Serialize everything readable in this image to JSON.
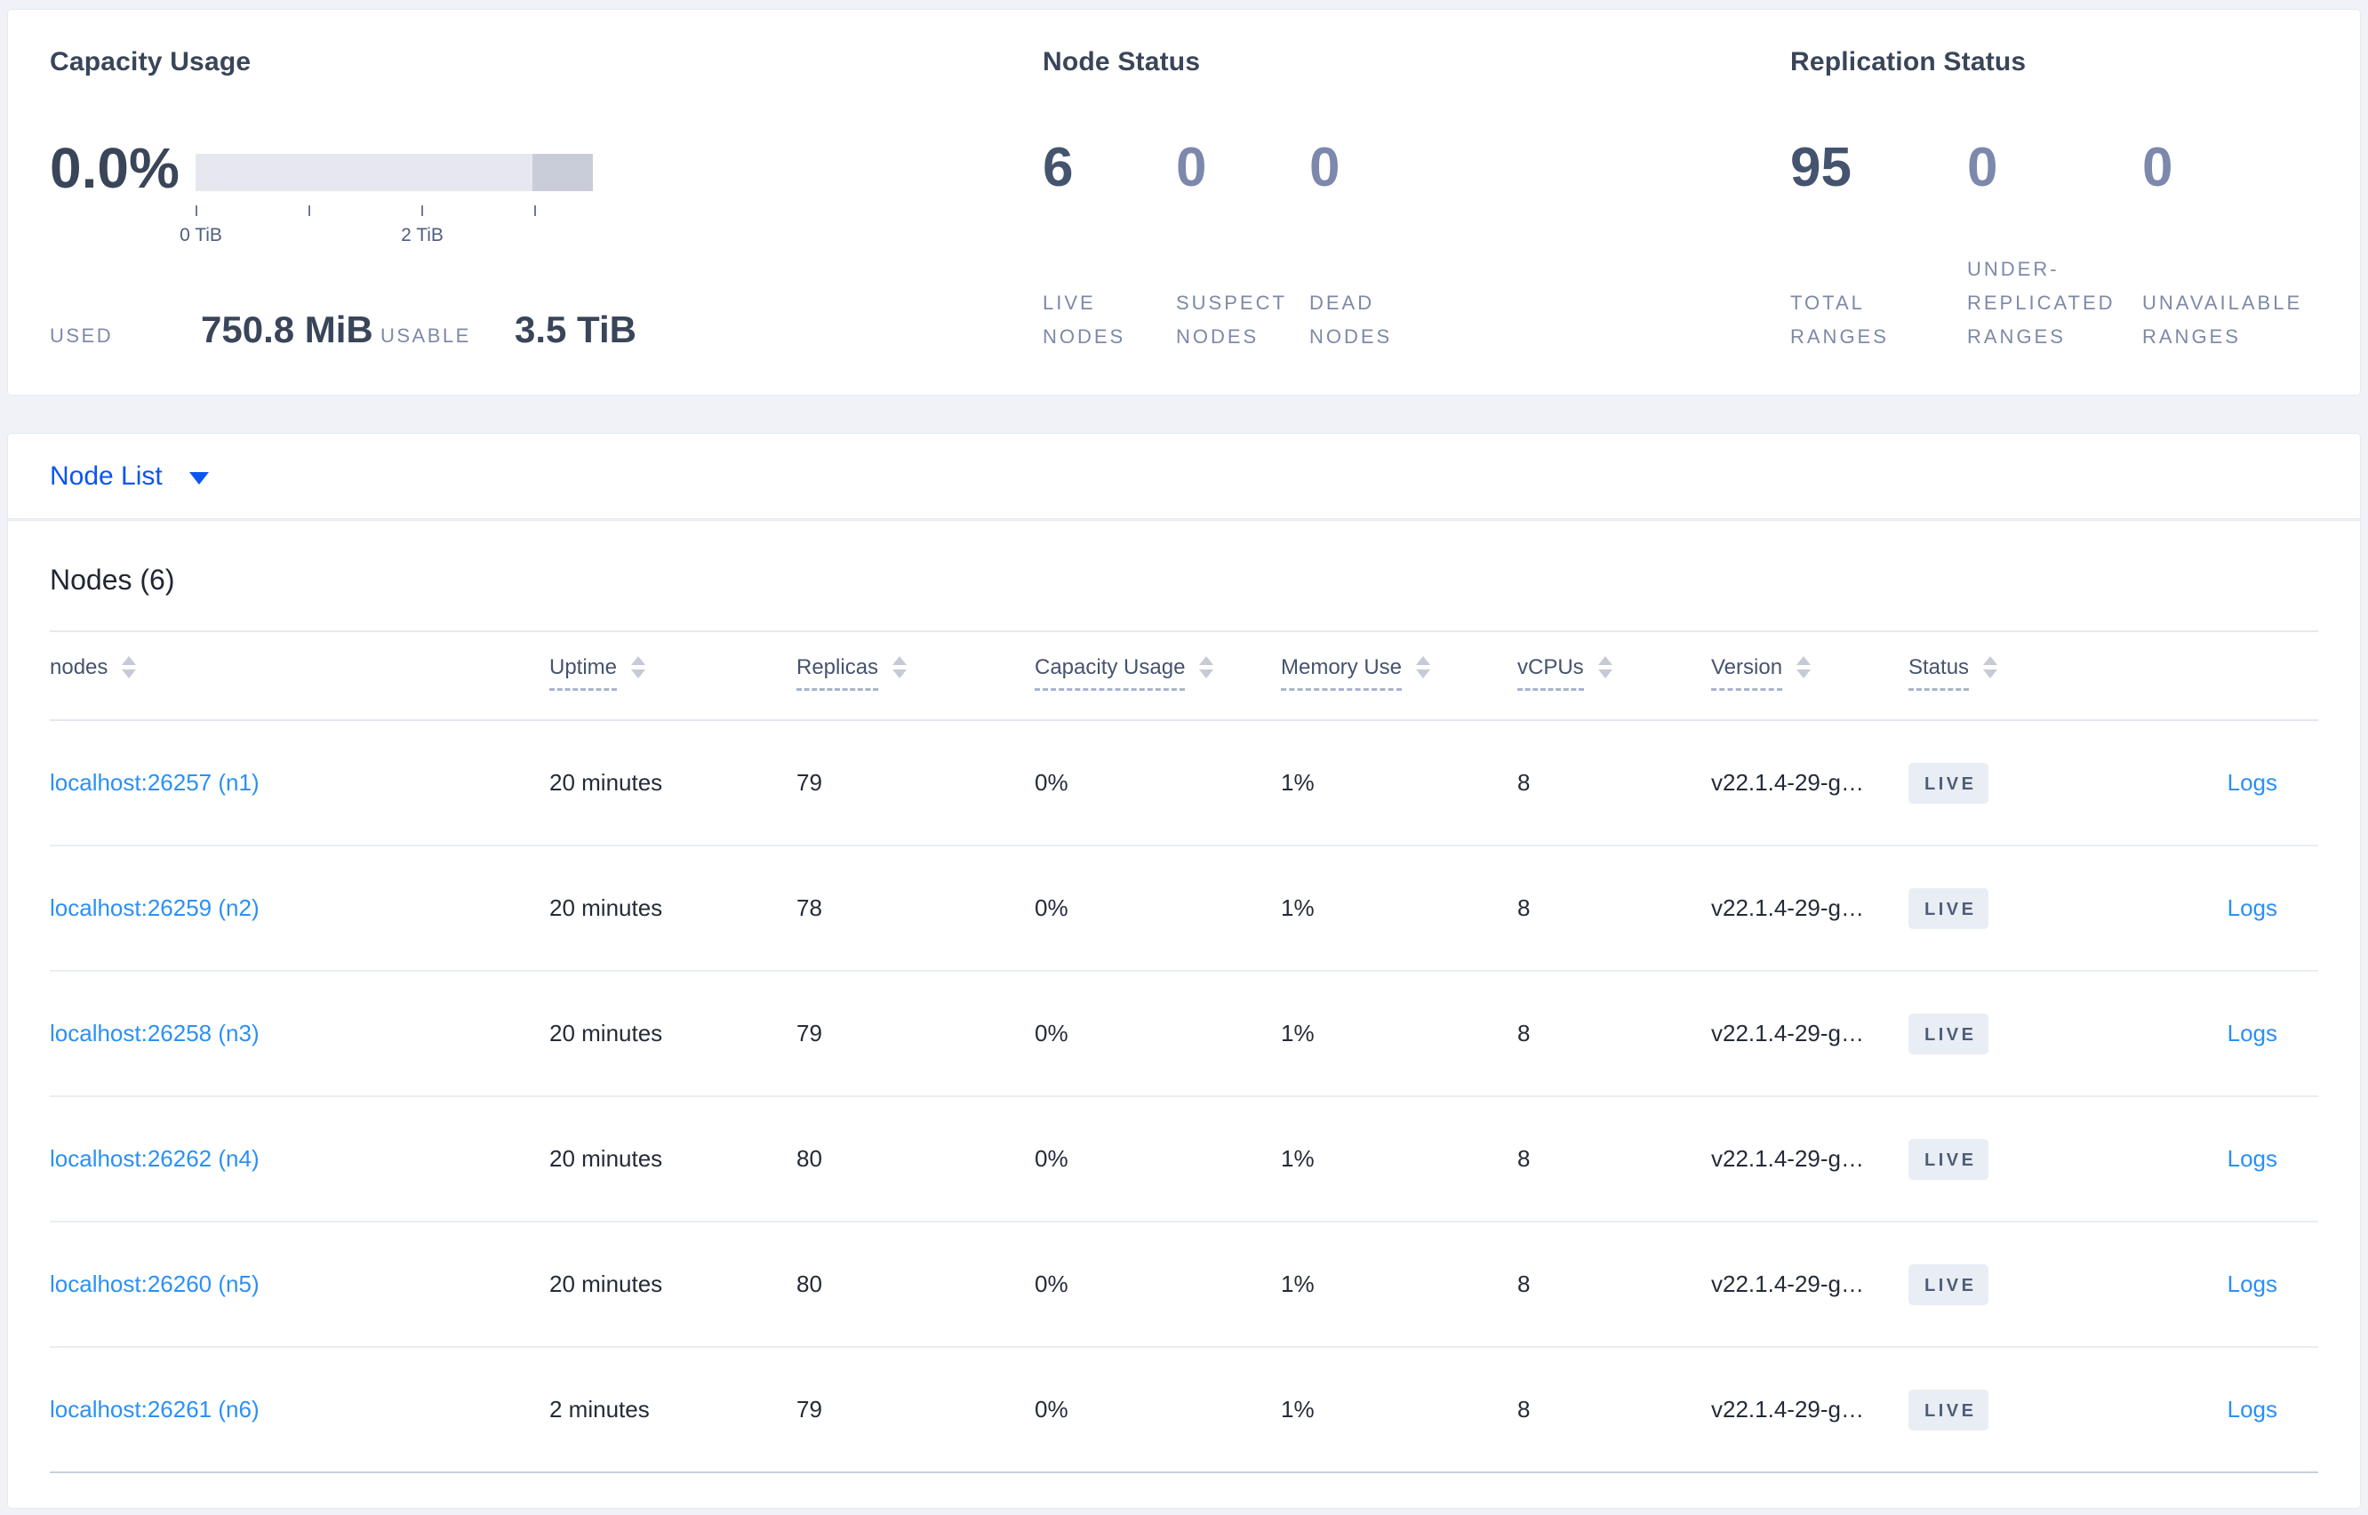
{
  "summary": {
    "capacity": {
      "title": "Capacity Usage",
      "percent": "0.0%",
      "used_label": "USED",
      "used_value": "750.8 MiB",
      "usable_label": "USABLE",
      "usable_value": "3.5 TiB",
      "gauge": {
        "tick_label_0": "0 TiB",
        "tick_label_2": "2 TiB"
      }
    },
    "node_status": {
      "title": "Node Status",
      "metrics": [
        {
          "value": "6",
          "label": "LIVE NODES"
        },
        {
          "value": "0",
          "label": "SUSPECT NODES"
        },
        {
          "value": "0",
          "label": "DEAD NODES"
        }
      ]
    },
    "replication": {
      "title": "Replication Status",
      "metrics": [
        {
          "value": "95",
          "label": "TOTAL RANGES"
        },
        {
          "value": "0",
          "label": "UNDER-REPLICATED RANGES"
        },
        {
          "value": "0",
          "label": "UNAVAILABLE RANGES"
        }
      ]
    }
  },
  "node_list_bar": {
    "label": "Node List"
  },
  "nodes_table": {
    "heading": "Nodes (6)",
    "columns": [
      "nodes",
      "Uptime",
      "Replicas",
      "Capacity Usage",
      "Memory Use",
      "vCPUs",
      "Version",
      "Status"
    ],
    "rows": [
      {
        "node": "localhost:26257 (n1)",
        "uptime": "20 minutes",
        "replicas": "79",
        "capacity": "0%",
        "memory": "1%",
        "vcpus": "8",
        "version": "v22.1.4-29-g…",
        "status": "LIVE",
        "logs": "Logs"
      },
      {
        "node": "localhost:26259 (n2)",
        "uptime": "20 minutes",
        "replicas": "78",
        "capacity": "0%",
        "memory": "1%",
        "vcpus": "8",
        "version": "v22.1.4-29-g…",
        "status": "LIVE",
        "logs": "Logs"
      },
      {
        "node": "localhost:26258 (n3)",
        "uptime": "20 minutes",
        "replicas": "79",
        "capacity": "0%",
        "memory": "1%",
        "vcpus": "8",
        "version": "v22.1.4-29-g…",
        "status": "LIVE",
        "logs": "Logs"
      },
      {
        "node": "localhost:26262 (n4)",
        "uptime": "20 minutes",
        "replicas": "80",
        "capacity": "0%",
        "memory": "1%",
        "vcpus": "8",
        "version": "v22.1.4-29-g…",
        "status": "LIVE",
        "logs": "Logs"
      },
      {
        "node": "localhost:26260 (n5)",
        "uptime": "20 minutes",
        "replicas": "80",
        "capacity": "0%",
        "memory": "1%",
        "vcpus": "8",
        "version": "v22.1.4-29-g…",
        "status": "LIVE",
        "logs": "Logs"
      },
      {
        "node": "localhost:26261 (n6)",
        "uptime": "2 minutes",
        "replicas": "79",
        "capacity": "0%",
        "memory": "1%",
        "vcpus": "8",
        "version": "v22.1.4-29-g…",
        "status": "LIVE",
        "logs": "Logs"
      }
    ]
  },
  "colors": {
    "accent_blue": "#0b55f0",
    "link_blue": "#2b90f5",
    "dark_slate": "#394559",
    "muted_slate": "#7d89a8",
    "badge_bg": "#e9edf4",
    "bar_light": "#e7e8ef",
    "bar_dark": "#c9cdd9",
    "page_bg": "#f0f2f8"
  }
}
